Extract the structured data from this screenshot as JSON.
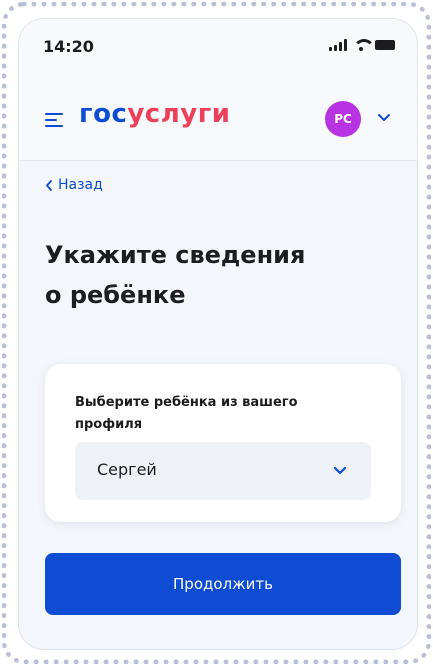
{
  "status_bar": {
    "time": "14:20"
  },
  "header": {
    "logo_part1": "гос",
    "logo_part2": "услуги",
    "avatar_initials": "PC",
    "accent_color": "#0d4cd3",
    "logo_red": "#ee3f58",
    "avatar_color": "#b833e1"
  },
  "nav": {
    "back_label": "Назад"
  },
  "page": {
    "title_line1": "Укажите сведения",
    "title_line2": "о ребёнке"
  },
  "form": {
    "field_label_line1": "Выберите ребёнка из вашего",
    "field_label_line2": "профиля",
    "selected_child": "Сергей"
  },
  "actions": {
    "continue_label": "Продолжить"
  },
  "icons": [
    "menu-icon",
    "chevron-down-icon",
    "chevron-left-icon",
    "signal-icon",
    "wifi-icon",
    "battery-icon"
  ]
}
